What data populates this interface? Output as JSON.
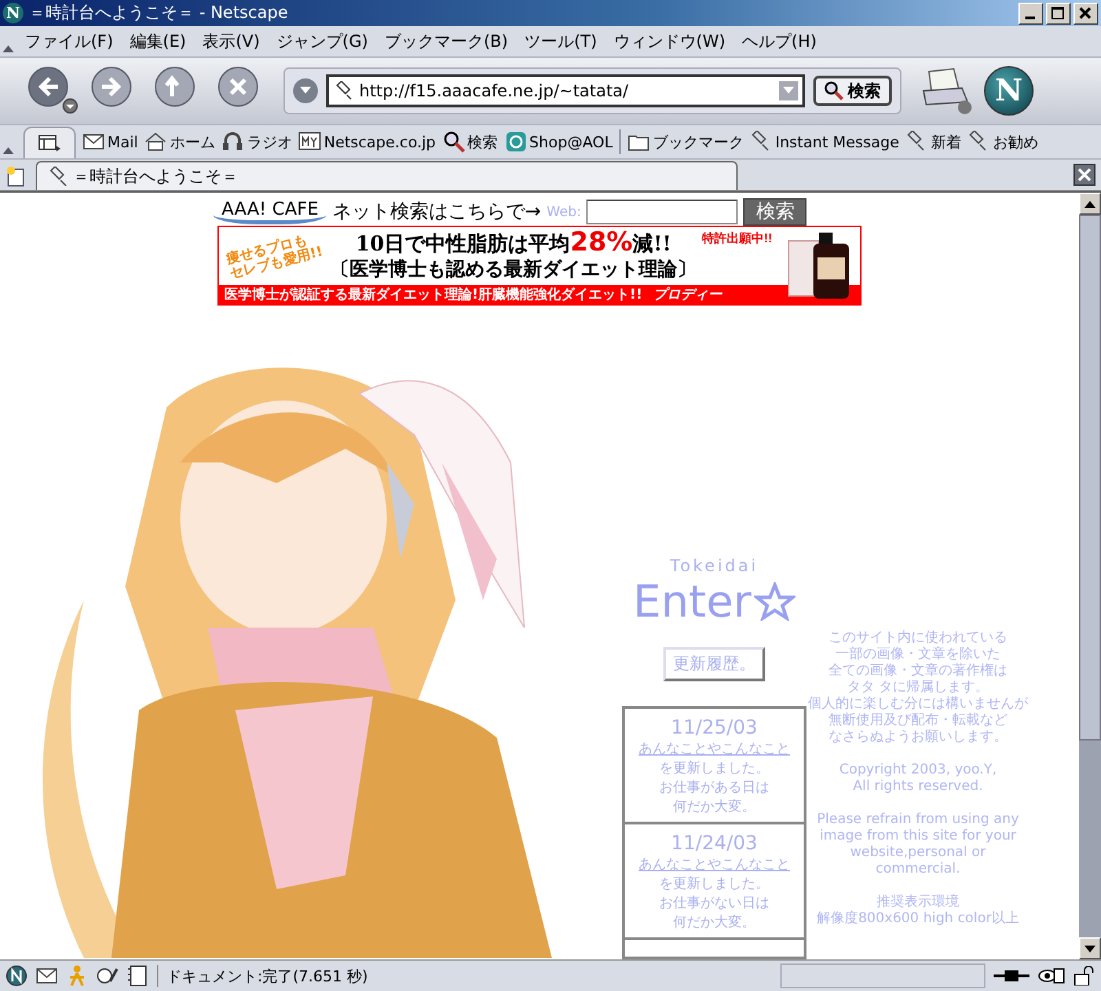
{
  "window": {
    "title": "＝時計台へようこそ＝ - Netscape",
    "logo": "N"
  },
  "menu": [
    "ファイル(F)",
    "編集(E)",
    "表示(V)",
    "ジャンプ(G)",
    "ブックマーク(B)",
    "ツール(T)",
    "ウィンドウ(W)",
    "ヘルプ(H)"
  ],
  "nav_toolbar": {
    "url": "http://f15.aaacafe.ne.jp/~tatata/",
    "search_button": "検索",
    "logo": "N"
  },
  "personal_toolbar": [
    {
      "kind": "mail",
      "label": "Mail"
    },
    {
      "kind": "home",
      "label": "ホーム"
    },
    {
      "kind": "radio",
      "label": "ラジオ"
    },
    {
      "kind": "my",
      "label": "Netscape.co.jp"
    },
    {
      "kind": "search",
      "label": "検索"
    },
    {
      "kind": "shop",
      "label": "Shop@AOL"
    },
    {
      "kind": "folder",
      "label": "ブックマーク"
    },
    {
      "kind": "link",
      "label": "Instant Message"
    },
    {
      "kind": "link",
      "label": "新着"
    },
    {
      "kind": "link",
      "label": "お勧め"
    }
  ],
  "tabs": [
    {
      "label": "＝時計台へようこそ＝",
      "selected": true
    }
  ],
  "search_bar": {
    "brand": "AAA! CAFE",
    "prompt": "ネット検索はこちらで→",
    "field_label": "Web:",
    "button": "検索"
  },
  "ad": {
    "tagline": [
      "痩せるプロも",
      "セレブも愛用!!"
    ],
    "headline": "10日で中性脂肪は平均**28%**減!!",
    "badge": "特許出願中!!",
    "subhead": "〔医学博士も認める最新ダイエット理論〕",
    "footer": "医学博士が認証する最新ダイエット理論!肝臓機能強化ダイエット!!",
    "brand": "プロディー"
  },
  "site": {
    "subtitle": "Tokeidai",
    "enter": "Enter",
    "history_button": "更新履歴。",
    "updates": [
      {
        "date": "11/25/03",
        "link": "あんなことやこんなこと",
        "lines": [
          "を更新しました。",
          "お仕事がある日は",
          "何だか大変。"
        ]
      },
      {
        "date": "11/24/03",
        "link": "あんなことやこんなこと",
        "lines": [
          "を更新しました。",
          "お仕事がない日は",
          "何だか大変。"
        ]
      }
    ],
    "notice": [
      [
        "このサイト内に使われている",
        "一部の画像・文章を除いた",
        "全ての画像・文章の著作権は",
        "タタ タに帰属します。",
        "個人的に楽しむ分には構いませんが",
        "無断使用及び配布・転載など",
        "なさらぬようお願いします。"
      ],
      [
        "Copyright 2003, yoo.Y,",
        "All rights reserved."
      ],
      [
        "Please refrain from using any",
        "image from this site for your",
        "website,personal or",
        "commercial."
      ],
      [
        "推奨表示環境",
        "解像度800x600 high color以上"
      ]
    ]
  },
  "status_bar": {
    "text": "ドキュメント:完了(7.651 秒)"
  }
}
